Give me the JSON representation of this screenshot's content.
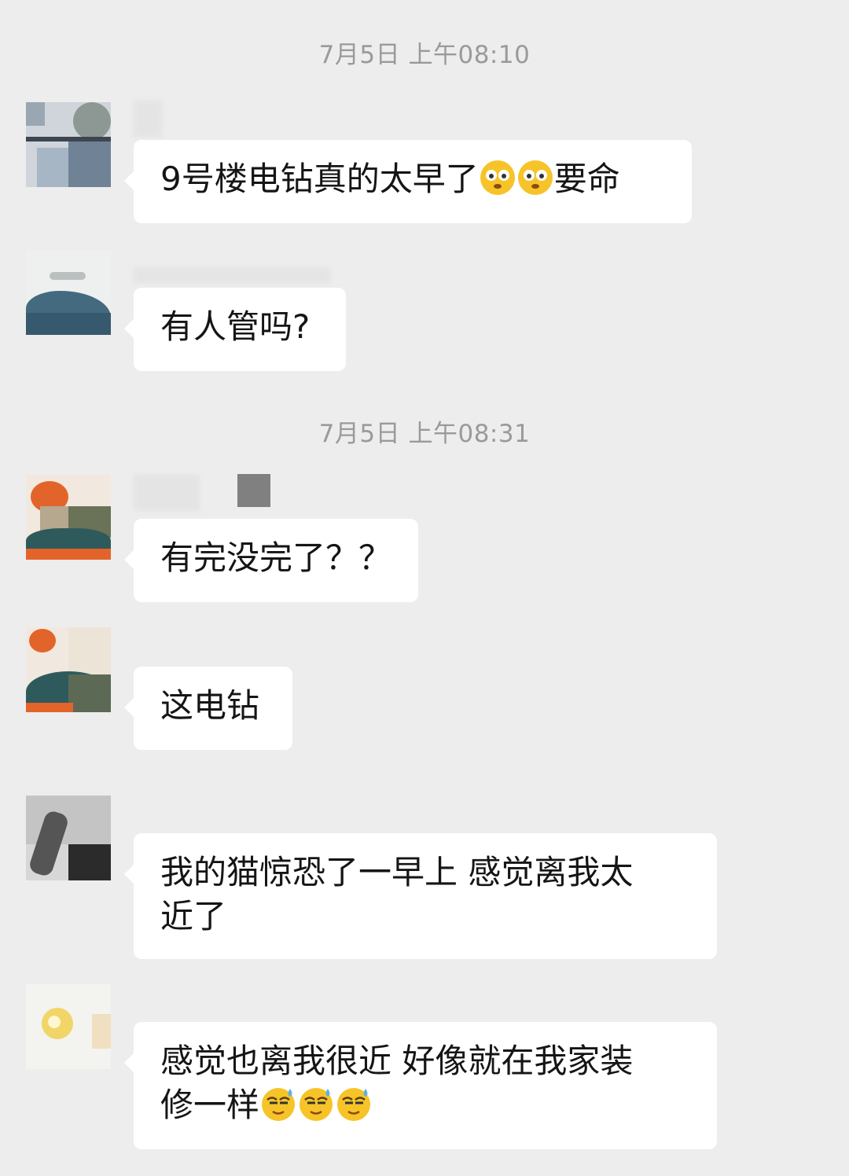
{
  "timestamps": [
    {
      "text": "7月5日 上午08:10"
    },
    {
      "text": "7月5日 上午08:31"
    }
  ],
  "messages": [
    {
      "text": "9号楼电钻真的太早了",
      "emojis": [
        "dizzy-face",
        "dizzy-face"
      ],
      "suffix": "要命"
    },
    {
      "text": "有人管吗?"
    },
    {
      "text": "有完没完了？？"
    },
    {
      "text": "这电钻"
    },
    {
      "line1": "我的猫惊恐了一早上 感觉离我太",
      "line2": "近了"
    },
    {
      "line1": "感觉也离我很近 好像就在我家装",
      "line2": "修一样",
      "emojis": [
        "sweat-face",
        "sweat-face",
        "sweat-face"
      ]
    }
  ],
  "colors": {
    "background": "#ededed",
    "bubble": "#ffffff",
    "timestamp": "#9a9a9a",
    "emoji_yellow": "#f6c429"
  }
}
